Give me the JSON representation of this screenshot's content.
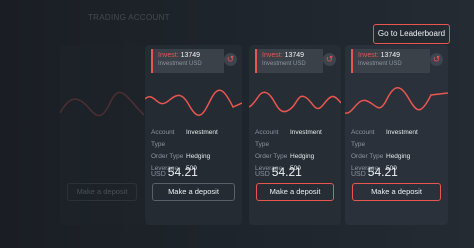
{
  "header": {
    "faded_title": "TRADING ACCOUNT",
    "leaderboard_button": "Go to Leaderboard"
  },
  "cards": [
    {
      "invest_label": "Invest:",
      "invest_value": "13749",
      "sub_label": "Investment USD",
      "specs": [
        {
          "key": "Account Type",
          "value": "Investment"
        },
        {
          "key": "Order Type",
          "value": "Hedging"
        },
        {
          "key": "Leverage",
          "value": "500"
        }
      ],
      "currency": "USD",
      "amount": "54.21",
      "deposit_label": "Make a deposit"
    },
    {
      "invest_label": "Invest:",
      "invest_value": "13749",
      "sub_label": "Investment USD",
      "specs": [
        {
          "key": "Account Type",
          "value": "Investment"
        },
        {
          "key": "Order Type",
          "value": "Hedging"
        },
        {
          "key": "Leverage",
          "value": "500"
        }
      ],
      "currency": "USD",
      "amount": "54.21",
      "deposit_label": "Make a deposit"
    },
    {
      "invest_label": "Invest:",
      "invest_value": "13749",
      "sub_label": "Investment USD",
      "specs": [
        {
          "key": "Account Type",
          "value": "Investment"
        },
        {
          "key": "Order Type",
          "value": "Hedging"
        },
        {
          "key": "Leverage",
          "value": "500"
        }
      ],
      "currency": "USD",
      "amount": "54.21",
      "deposit_label": "Make a deposit"
    }
  ],
  "colors": {
    "accent": "#e8564f",
    "card": "#262d35",
    "background": "#1c2128"
  },
  "icons": {
    "history": "history-icon"
  }
}
